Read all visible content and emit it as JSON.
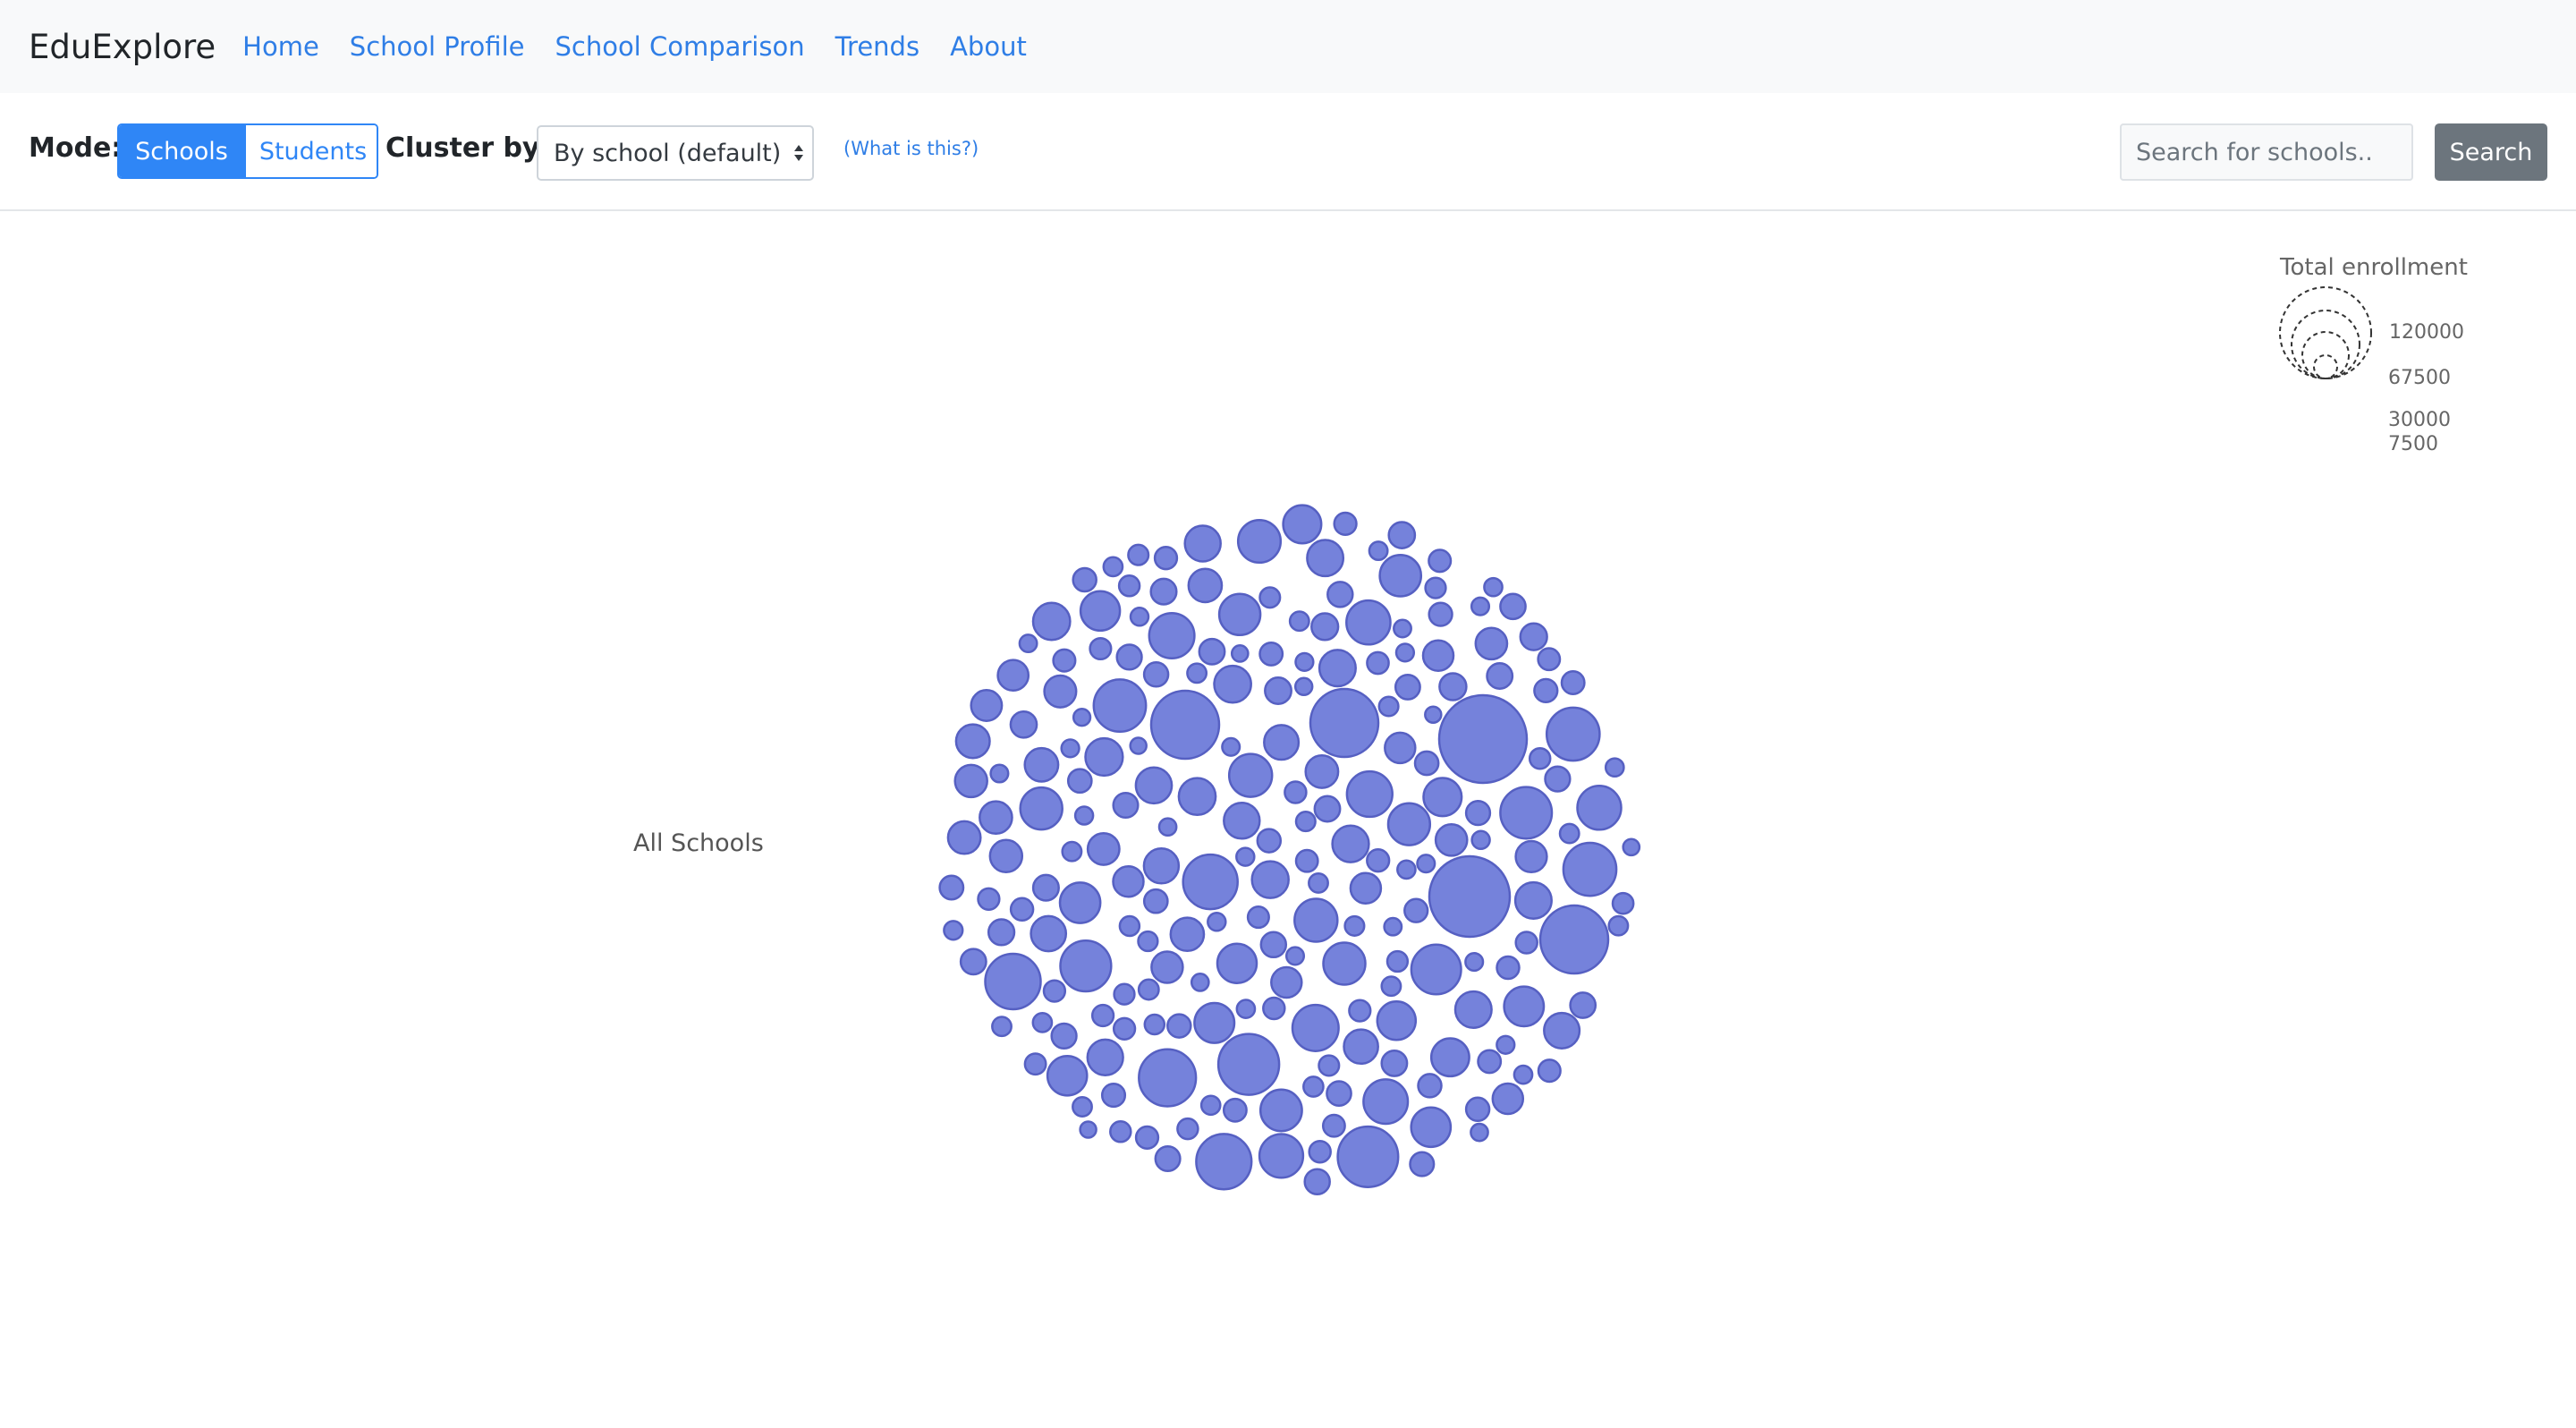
{
  "navbar": {
    "brand": "EduExplore",
    "links": [
      "Home",
      "School Profile",
      "School Comparison",
      "Trends",
      "About"
    ]
  },
  "toolbar": {
    "mode_label": "Mode:",
    "modes": [
      "Schools",
      "Students"
    ],
    "active_mode": "Schools",
    "cluster_label": "Cluster by:",
    "cluster_value": "By school (default)",
    "help_link": "(What is this?)",
    "search_placeholder": "Search for schools..",
    "search_button": "Search"
  },
  "chart": {
    "cluster_name": "All Schools",
    "bubble_color": "#7582db",
    "legend": {
      "title": "Total enrollment",
      "values": [
        "120000",
        "67500",
        "30000",
        "7500"
      ]
    }
  }
}
